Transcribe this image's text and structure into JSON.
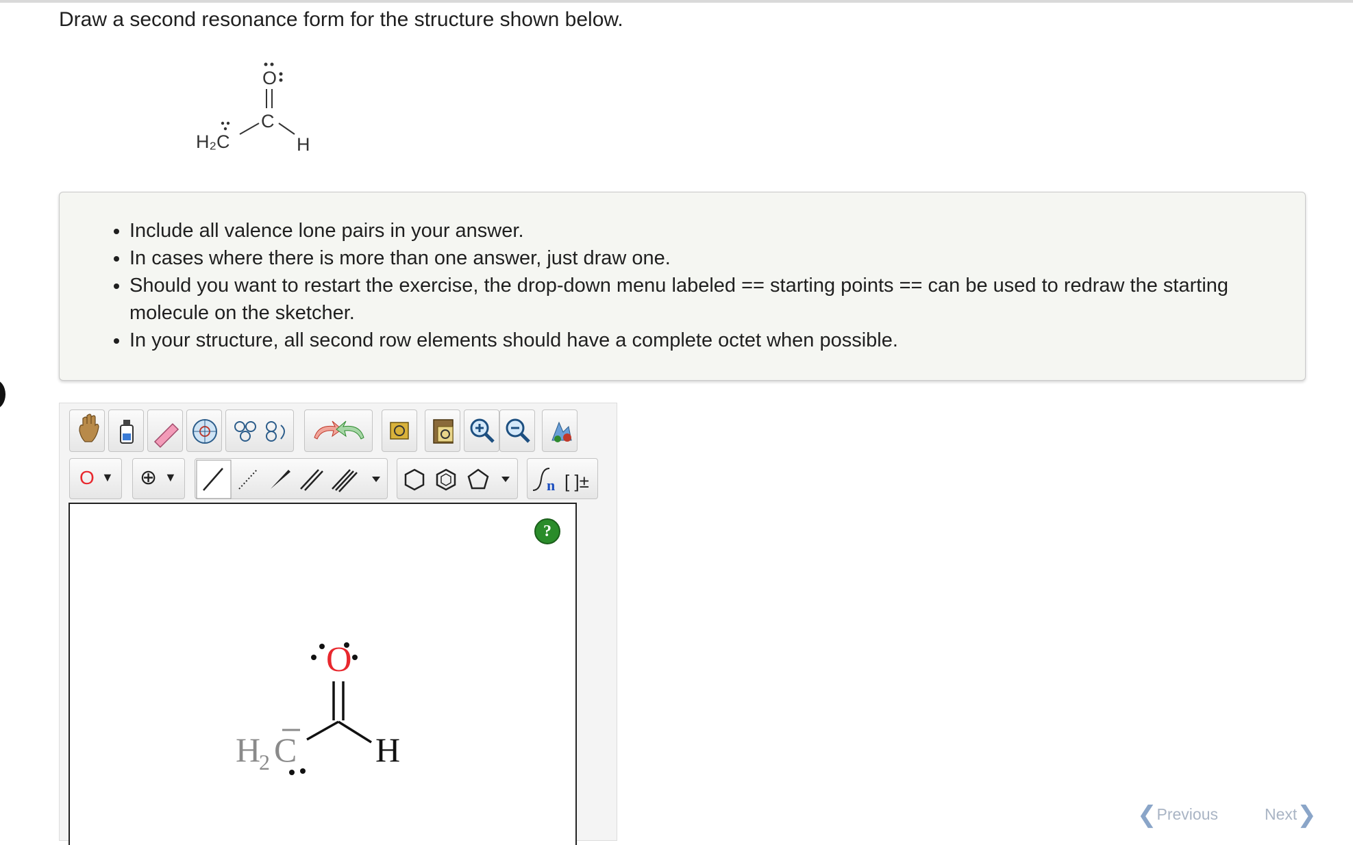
{
  "question": "Draw a second resonance form for the structure shown below.",
  "given_molecule": {
    "atoms": {
      "ch2": "H₂C",
      "carbon": "C",
      "oxygen": "O",
      "hydrogen": "H"
    },
    "lone_pairs": {
      "oxygen": ": :",
      "ch2": ":"
    }
  },
  "instructions": [
    "Include all valence lone pairs in your answer.",
    "In cases where there is more than one answer, just draw one.",
    "Should you want to restart the exercise, the drop-down menu labeled == starting points == can be used to redraw the starting molecule on the sketcher.",
    "In your structure, all second row elements should have a complete octet when possible."
  ],
  "toolbar": {
    "row1": [
      "hand-tool",
      "erase-all-tool",
      "eraser-tool",
      "ring-template-tool",
      "template-library-tool",
      "rotate-tool",
      "undo",
      "redo",
      "copy",
      "paste",
      "zoom-in",
      "zoom-out",
      "clean-structure"
    ],
    "element_selector_value": "O",
    "charge_selector": "⊕",
    "sgroup_n": "n",
    "bracket_label": "[ ]±"
  },
  "help_button": "?",
  "canvas_molecule": {
    "ch2": "H",
    "ch2_sub": "2",
    "ch2_c": "C",
    "carbanion_bar": "–",
    "oxygen": "O",
    "hydrogen": "H"
  },
  "nav": {
    "previous": "Previous",
    "next": "Next"
  },
  "colors": {
    "oxygen": "#e8282e",
    "help_green": "#2a8c2a",
    "nav_disabled": "#a9b4c4"
  }
}
